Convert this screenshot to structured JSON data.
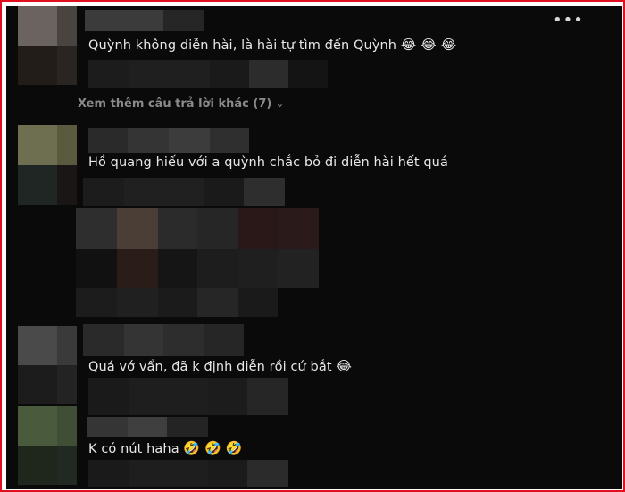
{
  "menu": {
    "icon": "more-horizontal-icon",
    "glyph": "•••"
  },
  "thread": {
    "more_replies_label": "Xem thêm câu trả lời khác (7)",
    "chevron_glyph": "⌄"
  },
  "comments": [
    {
      "text": "Quỳnh không diễn hài, là hài tự tìm đến Quỳnh",
      "emojis": "😂 😂 😂"
    },
    {
      "text": "Hồ quang hiếu với a quỳnh chắc bỏ đi diễn hài hết quá",
      "emojis": ""
    },
    {
      "text": "Quá vớ vẩn, đã k định diễn rồi cứ bắt",
      "emojis": "😂"
    },
    {
      "text": "K có nút haha",
      "emojis": "🤣 🤣 🤣"
    }
  ],
  "colors": {
    "background": "#0a0a0a",
    "text": "#e8e8e8",
    "muted": "#8a8a8a",
    "frame_border": "#e0101e"
  }
}
